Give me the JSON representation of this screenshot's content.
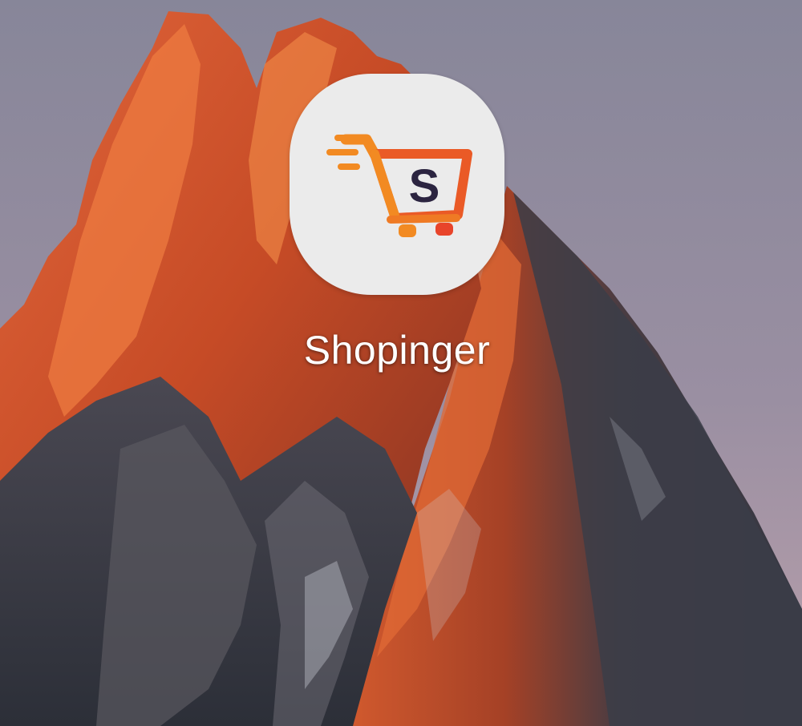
{
  "home_screen": {
    "wallpaper": {
      "subject": "mountain-peak-at-sunset",
      "colors": {
        "sky_top": "#8a8a9c",
        "sky_bottom": "#b49aa8",
        "rock_lit": "#d9582a",
        "rock_highlight": "#ef7a3c",
        "rock_shadow": "#3e3f4a"
      }
    },
    "app": {
      "label": "Shopinger",
      "icon": "shopping-cart-s-logo-icon",
      "icon_letter": "S",
      "colors": {
        "icon_background": "#ebebeb",
        "cart_orange": "#f28a22",
        "cart_red": "#e8442a",
        "letter": "#2b2440"
      }
    }
  }
}
